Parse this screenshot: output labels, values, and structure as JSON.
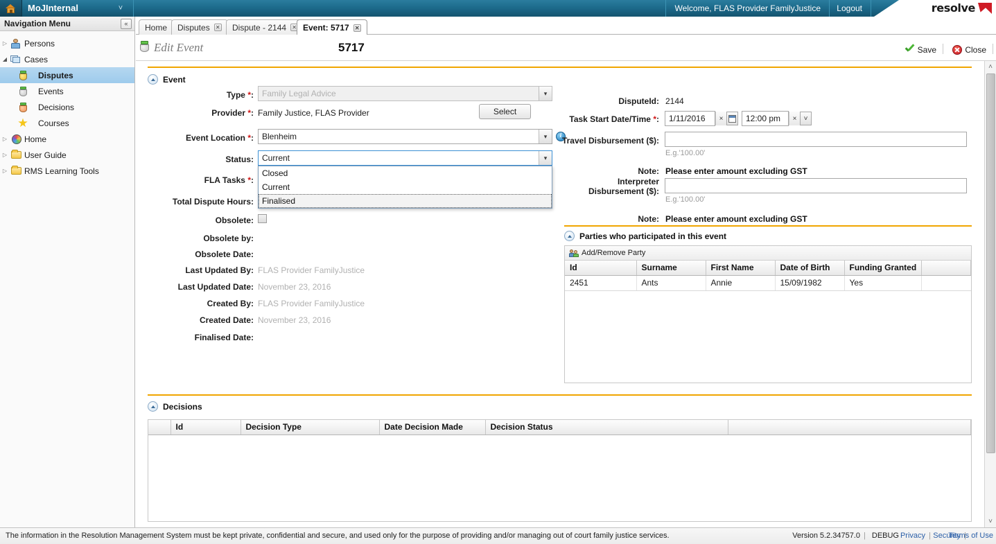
{
  "topbar": {
    "home_icon": "home-icon",
    "app_title": "MoJInternal",
    "chevron": "˅",
    "welcome": "Welcome, FLAS Provider FamilyJustice",
    "logout": "Logout",
    "logo_text": "resolve",
    "logo_mark": "check-mark"
  },
  "nav": {
    "header": "Navigation Menu",
    "collapse_label": "«",
    "items": [
      {
        "label": "Persons",
        "icon": "person-icon",
        "arrow": "▷",
        "level": 0,
        "selected": false
      },
      {
        "label": "Cases",
        "icon": "cases-icon",
        "arrow": "◢",
        "level": 0,
        "selected": false
      },
      {
        "label": "Disputes",
        "icon": "cylinder-yellow-icon",
        "arrow": "",
        "level": 1,
        "selected": true
      },
      {
        "label": "Events",
        "icon": "cylinder-gray-icon",
        "arrow": "",
        "level": 1,
        "selected": false
      },
      {
        "label": "Decisions",
        "icon": "cylinder-orange-icon",
        "arrow": "",
        "level": 1,
        "selected": false
      },
      {
        "label": "Courses",
        "icon": "star-icon",
        "arrow": "",
        "level": 1,
        "selected": false
      },
      {
        "label": "Home",
        "icon": "globe-icon",
        "arrow": "▷",
        "level": 0,
        "selected": false
      },
      {
        "label": "User Guide",
        "icon": "folder-icon",
        "arrow": "▷",
        "level": 0,
        "selected": false
      },
      {
        "label": "RMS Learning Tools",
        "icon": "folder-icon",
        "arrow": "▷",
        "level": 0,
        "selected": false
      }
    ]
  },
  "tabs": [
    {
      "label": "Home",
      "closable": false,
      "active": false
    },
    {
      "label": "Disputes",
      "closable": true,
      "active": false
    },
    {
      "label": "Dispute - 2144",
      "closable": true,
      "active": false
    },
    {
      "label": "Event: 5717",
      "closable": true,
      "active": true
    }
  ],
  "page_header": {
    "icon": "event-cylinder-icon",
    "title": "Edit Event",
    "record_id": "5717",
    "save_label": "Save",
    "close_label": "Close"
  },
  "event_section": {
    "title": "Event",
    "fields": {
      "type": {
        "label": "Type",
        "required": true,
        "value": "Family Legal Advice",
        "disabled": true
      },
      "provider": {
        "label": "Provider",
        "required": true,
        "value": "Family Justice, FLAS Provider",
        "button": "Select"
      },
      "event_location": {
        "label": "Event Location",
        "required": true,
        "value": "Blenheim",
        "info_icon": "info-icon"
      },
      "status": {
        "label": "Status",
        "required": false,
        "value": "Current",
        "open": true,
        "options": [
          "Closed",
          "Current",
          "Finalised"
        ],
        "highlighted": "Finalised"
      },
      "fla_tasks": {
        "label": "FLA Tasks",
        "required": true,
        "value": ""
      },
      "total_dispute_hours": {
        "label": "Total Dispute Hours",
        "required": false,
        "value": ""
      },
      "obsolete": {
        "label": "Obsolete",
        "checked": false
      },
      "obsolete_by": {
        "label": "Obsolete by",
        "value": ""
      },
      "obsolete_date": {
        "label": "Obsolete Date",
        "value": ""
      },
      "last_updated_by": {
        "label": "Last Updated By",
        "value": "FLAS Provider FamilyJustice"
      },
      "last_updated_date": {
        "label": "Last Updated Date",
        "value": "November 23, 2016"
      },
      "created_by": {
        "label": "Created By",
        "value": "FLAS Provider FamilyJustice"
      },
      "created_date": {
        "label": "Created Date",
        "value": "November 23, 2016"
      },
      "finalised_date": {
        "label": "Finalised Date",
        "value": ""
      },
      "dispute_id": {
        "label": "DisputeId",
        "value": "2144"
      },
      "task_start": {
        "label": "Task Start Date/Time",
        "required": true,
        "date_value": "1/11/2016",
        "time_value": "12:00 pm",
        "clear_glyph": "×",
        "calendar_icon": "calendar-icon",
        "time_arrow": "˅"
      },
      "travel_disbursement": {
        "label": "Travel Disbursement ($):",
        "value": "",
        "hint": "E.g.'100.00'",
        "note_label": "Note:",
        "note_value": "Please enter amount excluding GST"
      },
      "interpreter_disbursement": {
        "label_line1": "Interpreter",
        "label_line2": "Disbursement ($):",
        "value": "",
        "hint": "E.g.'100.00'",
        "note_label": "Note:",
        "note_value": "Please enter amount excluding GST"
      }
    }
  },
  "parties_section": {
    "title": "Parties who participated in this event",
    "toolbar_label": "Add/Remove Party",
    "toolbar_icon": "add-remove-party-icon",
    "columns": [
      "Id",
      "Surname",
      "First Name",
      "Date of Birth",
      "Funding Granted",
      ""
    ],
    "rows": [
      {
        "id": "2451",
        "surname": "Ants",
        "first_name": "Annie",
        "dob": "15/09/1982",
        "funding": "Yes",
        "blank": ""
      }
    ]
  },
  "decisions_section": {
    "title": "Decisions",
    "columns": [
      "",
      "Id",
      "Decision Type",
      "Date Decision Made",
      "Decision Status",
      ""
    ],
    "rows": []
  },
  "scrollbar": {
    "up": "˄",
    "down": "˅"
  },
  "footer": {
    "disclaimer": "The information in the Resolution Management System must be kept private, confidential and secure, and used only for the purpose of providing and/or managing out of court family justice services.",
    "version_label": "Version",
    "version": "5.2.34757.0",
    "environment": "DEBUG",
    "links": [
      "Privacy",
      "Security",
      "Terms of Use"
    ],
    "separator": "|"
  },
  "colors": {
    "topbar": "#1d6b8c",
    "accent_orange": "#f0a500",
    "selection_blue": "#9ecbec",
    "link_blue": "#2b5fa8",
    "required_red": "#d01414"
  }
}
